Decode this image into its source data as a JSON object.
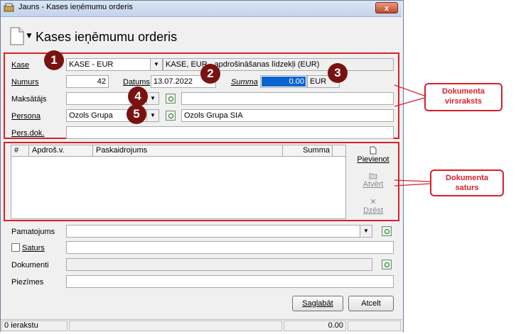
{
  "window": {
    "title": "Jauns - Kases ieņēmumu orderis",
    "close": "x",
    "heading": "Kases ieņēmumu orderis"
  },
  "header_section": {
    "kase_label": "Kase",
    "kase_value": "KASE - EUR",
    "kase_desc": "KASE, EUR - apdrošināšanas līdzekļi (EUR)",
    "numurs_label": "Numurs",
    "numurs_value": "42",
    "datums_label": "Datums",
    "datums_value": "13.07.2022",
    "summa_label": "Summa",
    "summa_value": "0.00",
    "currency": "EUR",
    "maksatajs_label": "Maksātājs",
    "maksatajs_value": "",
    "maksatajs_desc": "",
    "persona_label": "Persona",
    "persona_value": "Ozols Grupa",
    "persona_desc": "Ozols Grupa SIA",
    "persdok_label": "Pers.dok.",
    "persdok_value": ""
  },
  "grid": {
    "columns": [
      "#",
      "Apdroš.v.",
      "Paskaidrojums",
      "Summa"
    ],
    "rows": []
  },
  "grid_actions": {
    "add": "Pievienot",
    "open": "Atvērt",
    "delete": "Dzēst"
  },
  "footer_section": {
    "pamatojums_label": "Pamatojums",
    "pamatojums_value": "",
    "saturs_label": "Saturs",
    "saturs_value": "",
    "dokumenti_label": "Dokumenti",
    "dokumenti_value": "",
    "piezimes_label": "Piezīmes",
    "piezimes_value": ""
  },
  "buttons": {
    "save": "Saglabāt",
    "cancel": "Atcelt"
  },
  "status": {
    "records": "0 ierakstu",
    "total": "0.00"
  },
  "annotations": {
    "markers": [
      "1",
      "2",
      "3",
      "4",
      "5"
    ],
    "callout_header": "Dokumenta virsraksts",
    "callout_content": "Dokumenta saturs"
  },
  "colors": {
    "annotation_red": "#d9202a",
    "marker_fill": "#7a1212",
    "highlight_blue": "#0a64d0"
  }
}
